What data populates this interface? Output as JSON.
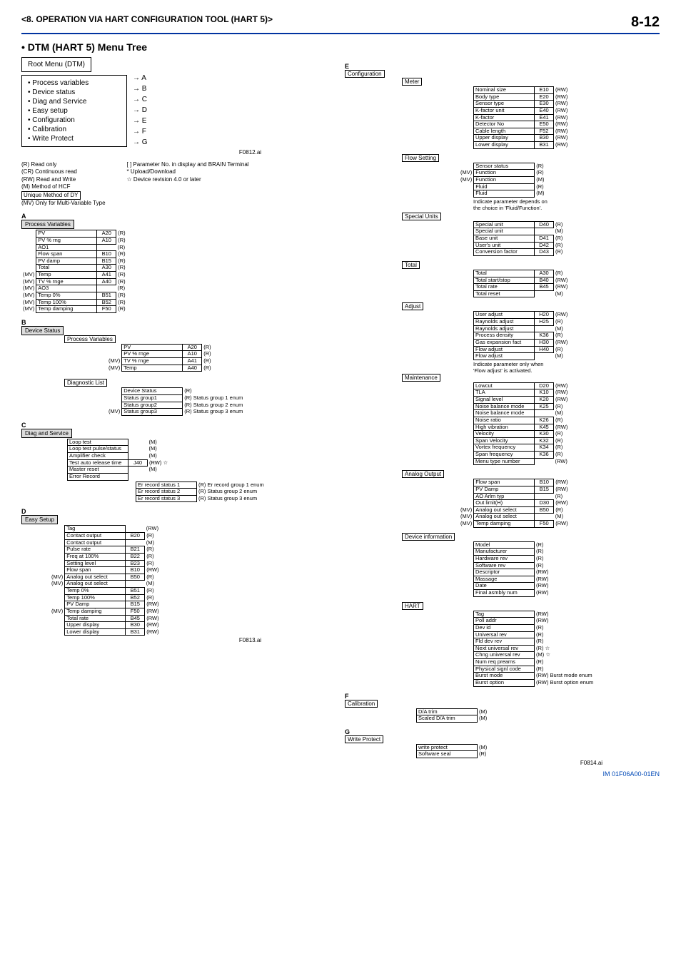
{
  "header": {
    "chapter": "<8.  OPERATION VIA HART CONFIGURATION TOOL (HART 5)>",
    "page": "8-12"
  },
  "title": "• DTM (HART 5) Menu Tree",
  "rootmenu_title": "Root Menu (DTM)",
  "rootmenu": [
    {
      "label": "• Process variables",
      "letter": "A"
    },
    {
      "label": "• Device status",
      "letter": "B"
    },
    {
      "label": "• Diag and Service",
      "letter": "C"
    },
    {
      "label": "• Easy setup",
      "letter": "D"
    },
    {
      "label": "• Configuration",
      "letter": "E"
    },
    {
      "label": "• Calibration",
      "letter": "F"
    },
    {
      "label": "• Write Protect",
      "letter": "G"
    }
  ],
  "fig_ids": {
    "root": "F0812.ai",
    "left": "F0813.ai",
    "right": "F0814.ai"
  },
  "legend": {
    "r": "(R) Read only",
    "cr": "(CR) Continuous read",
    "rw": "(RW) Read and Write",
    "m": "(M) Method of HCF",
    "dy": "Unique Method of DY",
    "mv": "(MV) Only for Multi-Variable Type",
    "bracket": "[   ] Parameter No. in display and BRAIN Terminal",
    "star": "* Upload/Download",
    "rev": "☆ Device revision 4.0 or later"
  },
  "A": {
    "title": "Process Variables",
    "items": [
      {
        "pre": "",
        "name": "PV",
        "code": "A20",
        "perm": "(R)"
      },
      {
        "pre": "",
        "name": "PV % rng",
        "code": "A10",
        "perm": "(R)"
      },
      {
        "pre": "",
        "name": "AO1",
        "code": "",
        "perm": "(R)"
      },
      {
        "pre": "",
        "name": "Flow span",
        "code": "B10",
        "perm": "(R)"
      },
      {
        "pre": "",
        "name": "PV damp",
        "code": "B15",
        "perm": "(R)"
      },
      {
        "pre": "",
        "name": "Total",
        "code": "A30",
        "perm": "(R)"
      },
      {
        "pre": "(MV)",
        "name": "Temp",
        "code": "A41",
        "perm": "(R)"
      },
      {
        "pre": "(MV)",
        "name": "TV % rnge",
        "code": "A40",
        "perm": "(R)"
      },
      {
        "pre": "(MV)",
        "name": "AO3",
        "code": "",
        "perm": "(R)"
      },
      {
        "pre": "(MV)",
        "name": "Temp 0%",
        "code": "B51",
        "perm": "(R)"
      },
      {
        "pre": "(MV)",
        "name": "Temp 100%",
        "code": "B52",
        "perm": "(R)"
      },
      {
        "pre": "(MV)",
        "name": "Temp damping",
        "code": "F50",
        "perm": "(R)"
      }
    ]
  },
  "B": {
    "title": "Device Status",
    "pv_title": "Process Variables",
    "pv": [
      {
        "pre": "",
        "name": "PV",
        "code": "A20",
        "perm": "(R)"
      },
      {
        "pre": "",
        "name": "PV % rnge",
        "code": "A10",
        "perm": "(R)"
      },
      {
        "pre": "(MV)",
        "name": "TV % rnge",
        "code": "A41",
        "perm": "(R)"
      },
      {
        "pre": "(MV)",
        "name": "Temp",
        "code": "A40",
        "perm": "(R)"
      }
    ],
    "diag_title": "Diagnostic List",
    "diag": [
      {
        "pre": "",
        "name": "Device Status",
        "code": "",
        "perm": "(R)"
      },
      {
        "pre": "",
        "name": "Status group1",
        "code": "",
        "perm": "(R) Status group 1 enum"
      },
      {
        "pre": "",
        "name": "Status group2",
        "code": "",
        "perm": "(R) Status group 2 enum"
      },
      {
        "pre": "(MV)",
        "name": "Status group3",
        "code": "",
        "perm": "(R) Status group 3 enum"
      }
    ]
  },
  "C": {
    "title": "Diag and Service",
    "items": [
      {
        "pre": "",
        "name": "Loop test",
        "code": "",
        "perm": "(M)"
      },
      {
        "pre": "",
        "name": "Loop test pulse/status",
        "code": "",
        "perm": "(M)"
      },
      {
        "pre": "",
        "name": "Amplifier check",
        "code": "",
        "perm": "(M)"
      },
      {
        "pre": "",
        "name": "Test auto release time",
        "code": "J40",
        "perm": "(RW) ☆"
      },
      {
        "pre": "",
        "name": "Master reset",
        "code": "",
        "perm": "(M)"
      },
      {
        "pre": "",
        "name": "Error Record",
        "code": "",
        "perm": ""
      }
    ],
    "err": [
      {
        "name": "Er record status 1",
        "perm": "(R) Er record group 1 enum"
      },
      {
        "name": "Er record status 2",
        "perm": "(R) Status group 2 enum"
      },
      {
        "name": "Er record status 3",
        "perm": "(R) Status group 3 enum"
      }
    ]
  },
  "D": {
    "title": "Easy Setup",
    "items": [
      {
        "pre": "",
        "name": "Tag",
        "code": "",
        "perm": "(RW)"
      },
      {
        "pre": "",
        "name": "Contact output",
        "code": "B20",
        "perm": "(R)"
      },
      {
        "pre": "",
        "name": "Contact output",
        "code": "",
        "perm": "(M)"
      },
      {
        "pre": "",
        "name": "Pulse rate",
        "code": "B21",
        "perm": "(R)"
      },
      {
        "pre": "",
        "name": "Freq at 100%",
        "code": "B22",
        "perm": "(R)"
      },
      {
        "pre": "",
        "name": "Setting level",
        "code": "B23",
        "perm": "(R)"
      },
      {
        "pre": "",
        "name": "Flow span",
        "code": "B10",
        "perm": "(RW)"
      },
      {
        "pre": "(MV)",
        "name": "Analog out select",
        "code": "B50",
        "perm": "(R)"
      },
      {
        "pre": "(MV)",
        "name": "Analog out select",
        "code": "",
        "perm": "(M)"
      },
      {
        "pre": "",
        "name": "Temp 0%",
        "code": "B51",
        "perm": "(R)"
      },
      {
        "pre": "",
        "name": "Temp 100%",
        "code": "B52",
        "perm": "(R)"
      },
      {
        "pre": "",
        "name": "PV Damp",
        "code": "B15",
        "perm": "(RW)"
      },
      {
        "pre": "(MV)",
        "name": "Temp damping",
        "code": "F50",
        "perm": "(RW)"
      },
      {
        "pre": "",
        "name": "Total rate",
        "code": "B45",
        "perm": "(RW)"
      },
      {
        "pre": "",
        "name": "Upper display",
        "code": "B30",
        "perm": "(RW)"
      },
      {
        "pre": "",
        "name": "Lower display",
        "code": "B31",
        "perm": "(RW)"
      }
    ]
  },
  "E": {
    "title": "Configuration",
    "meter_title": "Meter",
    "meter": [
      {
        "name": "Nominal size",
        "code": "E10",
        "perm": "(RW)"
      },
      {
        "name": "Body type",
        "code": "E20",
        "perm": "(RW)"
      },
      {
        "name": "Sensor type",
        "code": "E30",
        "perm": "(RW)"
      },
      {
        "name": "K-factor unit",
        "code": "E40",
        "perm": "(RW)"
      },
      {
        "name": "K-factor",
        "code": "E41",
        "perm": "(RW)"
      },
      {
        "name": "Detector No",
        "code": "E50",
        "perm": "(RW)"
      },
      {
        "name": "Cable length",
        "code": "F52",
        "perm": "(RW)"
      },
      {
        "name": "Upper display",
        "code": "B30",
        "perm": "(RW)"
      },
      {
        "name": "Lower display",
        "code": "B31",
        "perm": "(RW)"
      }
    ],
    "flow_title": "Flow Setting",
    "flow": [
      {
        "pre": "",
        "name": "Sensor status",
        "code": "",
        "perm": "(R)"
      },
      {
        "pre": "(MV)",
        "name": "Function",
        "code": "",
        "perm": "(R)"
      },
      {
        "pre": "(MV)",
        "name": "Function",
        "code": "",
        "perm": "(M)"
      },
      {
        "pre": "",
        "name": "Fluid",
        "code": "",
        "perm": "(R)"
      },
      {
        "pre": "",
        "name": "Fluid",
        "code": "",
        "perm": "(M)"
      }
    ],
    "flow_note1": "Indicate parameter depends on",
    "flow_note2": "the choice in 'Fluid/Function'.",
    "special_title": "Special Units",
    "special": [
      {
        "name": "Special unit",
        "code": "D40",
        "perm": "(R)"
      },
      {
        "name": "Special unit",
        "code": "",
        "perm": "(M)"
      },
      {
        "name": "Base unit",
        "code": "D41",
        "perm": "(R)"
      },
      {
        "name": "User's unit",
        "code": "D42",
        "perm": "(R)"
      },
      {
        "name": "Conversion factor",
        "code": "D43",
        "perm": "(R)"
      }
    ],
    "total_title": "Total",
    "total": [
      {
        "name": "Total",
        "code": "A30",
        "perm": "(R)"
      },
      {
        "name": "Total start/stop",
        "code": "B40",
        "perm": "(RW)"
      },
      {
        "name": "Total rate",
        "code": "B45",
        "perm": "(RW)"
      },
      {
        "name": "Total reset",
        "code": "",
        "perm": "(M)"
      }
    ],
    "adjust_title": "Adjust",
    "adjust": [
      {
        "name": "User adjust",
        "code": "H20",
        "perm": "(RW)"
      },
      {
        "name": "Raynolds adjust",
        "code": "H25",
        "perm": "(R)"
      },
      {
        "name": "Raynolds adjust",
        "code": "",
        "perm": "(M)"
      },
      {
        "name": "Process density",
        "code": "K36",
        "perm": "(R)"
      },
      {
        "name": "Gas expansion fact",
        "code": "H30",
        "perm": "(RW)"
      },
      {
        "name": "Flow adjust",
        "code": "H40",
        "perm": "(R)"
      },
      {
        "name": "Flow adjust",
        "code": "",
        "perm": "(M)"
      }
    ],
    "adjust_note1": "Indicate parameter only when",
    "adjust_note2": "'Flow adjust' is activated.",
    "maint_title": "Maintenance",
    "maint": [
      {
        "name": "Lowcut",
        "code": "D20",
        "perm": "(RW)"
      },
      {
        "name": "TLA",
        "code": "K10",
        "perm": "(RW)"
      },
      {
        "name": "Signal level",
        "code": "K20",
        "perm": "(RW)"
      },
      {
        "name": "Noise balance mode",
        "code": "K25",
        "perm": "(R)"
      },
      {
        "name": "Noise balance mode",
        "code": "",
        "perm": "(M)"
      },
      {
        "name": "Noise ratio",
        "code": "K26",
        "perm": "(R)"
      },
      {
        "name": "High vibration",
        "code": "K45",
        "perm": "(RW)"
      },
      {
        "name": "Velocity",
        "code": "K30",
        "perm": "(R)"
      },
      {
        "name": "Span Velocity",
        "code": "K32",
        "perm": "(R)"
      },
      {
        "name": "Vortex frequency",
        "code": "K34",
        "perm": "(R)"
      },
      {
        "name": "Span frequency",
        "code": "K36",
        "perm": "(R)"
      },
      {
        "name": "Menu type number",
        "code": "",
        "perm": "(RW)"
      }
    ],
    "ao_title": "Analog Output",
    "ao": [
      {
        "pre": "",
        "name": "Flow span",
        "code": "B10",
        "perm": "(RW)"
      },
      {
        "pre": "",
        "name": "PV Damp",
        "code": "B15",
        "perm": "(RW)"
      },
      {
        "pre": "",
        "name": "AO Arlm typ",
        "code": "",
        "perm": "(R)"
      },
      {
        "pre": "",
        "name": "Out limit(H)",
        "code": "D30",
        "perm": "(RW)"
      },
      {
        "pre": "(MV)",
        "name": "Analog out select",
        "code": "B50",
        "perm": "(R)"
      },
      {
        "pre": "(MV)",
        "name": "Analog out select",
        "code": "",
        "perm": "(M)"
      },
      {
        "pre": "(MV)",
        "name": "Temp damping",
        "code": "F50",
        "perm": "(RW)"
      }
    ],
    "dev_title": "Device information",
    "dev": [
      {
        "name": "Model",
        "perm": "(R)"
      },
      {
        "name": "Manufacturer",
        "perm": "(R)"
      },
      {
        "name": "Hardware rev",
        "perm": "(R)"
      },
      {
        "name": "Software rev",
        "perm": "(R)"
      },
      {
        "name": "Descriptor",
        "perm": "(RW)"
      },
      {
        "name": "Massage",
        "perm": "(RW)"
      },
      {
        "name": "Date",
        "perm": "(RW)"
      },
      {
        "name": "Final asmbly num",
        "perm": "(RW)"
      }
    ],
    "hart_title": "HART",
    "hart": [
      {
        "name": "Tag",
        "perm": "(RW)"
      },
      {
        "name": "Poll addr",
        "perm": "(RW)"
      },
      {
        "name": "Dev id",
        "perm": "(R)"
      },
      {
        "name": "Universal rev",
        "perm": "(R)"
      },
      {
        "name": "Fld dev rev",
        "perm": "(R)"
      },
      {
        "name": "Next universal rev",
        "perm": "(R) ☆"
      },
      {
        "name": "Chng universal rev",
        "perm": "(M) ☆"
      },
      {
        "name": "Num req preams",
        "perm": "(R)"
      },
      {
        "name": "Physical signl code",
        "perm": "(R)"
      },
      {
        "name": "Burst mode",
        "perm": "(RW) Burst mode enum"
      },
      {
        "name": "Burst option",
        "perm": "(RW) Burst option enum"
      }
    ]
  },
  "F": {
    "title": "Calibration",
    "items": [
      {
        "name": "D/A trim",
        "perm": "(M)"
      },
      {
        "name": "Scaled D/A trim",
        "perm": "(M)"
      }
    ]
  },
  "G": {
    "title": "Write Protect",
    "items": [
      {
        "name": "write protect",
        "perm": "(M)"
      },
      {
        "name": "Software seal",
        "perm": "(R)"
      }
    ]
  },
  "footer": "IM 01F06A00-01EN"
}
